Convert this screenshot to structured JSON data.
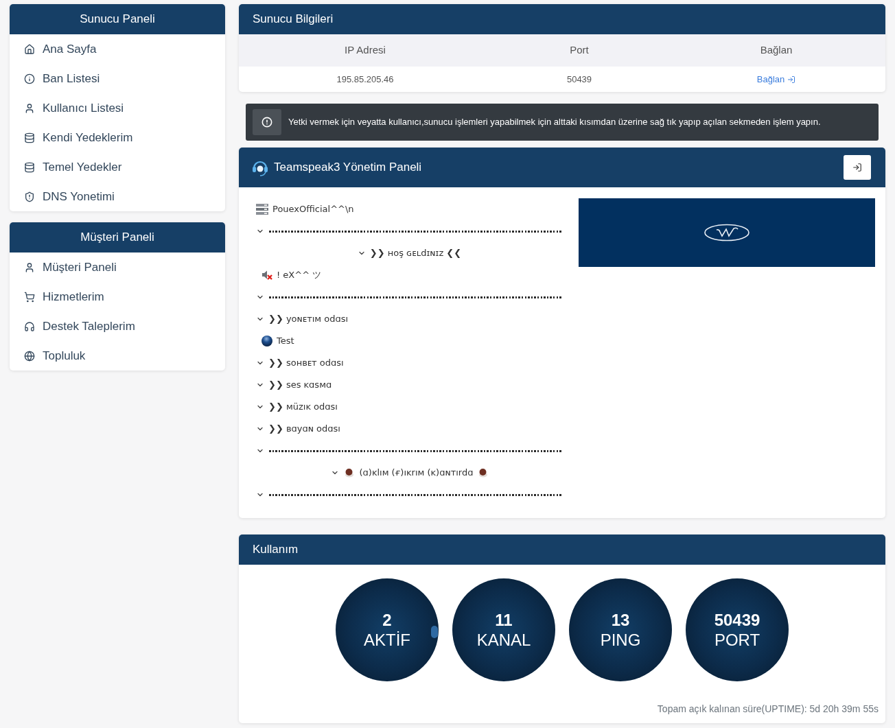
{
  "sidebar": [
    {
      "title": "Sunucu Paneli",
      "items": [
        "Ana Sayfa",
        "Ban Listesi",
        "Kullanıcı Listesi",
        "Kendi Yedeklerim",
        "Temel Yedekler",
        "DNS Yonetimi"
      ]
    },
    {
      "title": "Müşteri Paneli",
      "items": [
        "Müşteri Paneli",
        "Hizmetlerim",
        "Destek Taleplerim",
        "Topluluk"
      ]
    }
  ],
  "server_info": {
    "title": "Sunucu Bilgileri",
    "columns": [
      "IP Adresi",
      "Port",
      "Bağlan"
    ],
    "row": {
      "ip": "195.85.205.46",
      "port": "50439",
      "link": "Bağlan"
    }
  },
  "alert": {
    "text": "Yetki vermek için veyatta kullanıcı,sunucu işlemleri yapabilmek için alttaki kısımdan üzerine sağ tık yapıp açılan sekmeden işlem yapın."
  },
  "ts_panel": {
    "title": "Teamspeak3 Yönetim Paneli",
    "tree": {
      "server": "PouexOfficial^^\\n",
      "channels": [
        {
          "kind": "spacer",
          "expanded": true
        },
        {
          "kind": "centered",
          "name": "❯❯ ʜᴏş ɢᴇʟdɪɴɪᴢ ❮❮",
          "expanded": true,
          "children": [
            {
              "name": "! eX^^ ツ",
              "muted": true
            }
          ]
        },
        {
          "kind": "spacer",
          "expanded": true
        },
        {
          "kind": "channel",
          "name": "❯❯ yoɴᴇᴛıᴍ odɑsı",
          "expanded": true,
          "children": [
            {
              "name": "Test",
              "muted": false
            }
          ]
        },
        {
          "kind": "channel",
          "name": "❯❯ ꜱᴏʜʙᴇᴛ odɑsı",
          "expanded": true
        },
        {
          "kind": "channel",
          "name": "❯❯ ses ᴋɑsᴍɑ",
          "expanded": true
        },
        {
          "kind": "channel",
          "name": "❯❯ ᴍüᴢıᴋ odɑsı",
          "expanded": true
        },
        {
          "kind": "channel",
          "name": "❯❯ ʙɑyɑɴ odɑsı",
          "expanded": true
        },
        {
          "kind": "spacer",
          "expanded": true
        },
        {
          "kind": "ornate",
          "name": "(ɑ)ᴋlıᴍ (ғ)ıᴋrıᴍ (ᴋ)ɑɴᴛırdɑ",
          "expanded": true
        },
        {
          "kind": "spacer",
          "expanded": true
        }
      ]
    }
  },
  "usage": {
    "title": "Kullanım",
    "stats": [
      {
        "value": "2",
        "label": "AKTİF",
        "marker": true
      },
      {
        "value": "11",
        "label": "KANAL",
        "marker": false
      },
      {
        "value": "13",
        "label": "PING",
        "marker": false
      },
      {
        "value": "50439",
        "label": "PORT",
        "marker": false
      }
    ],
    "uptime": "Topam açık kalınan süre(UPTIME): 5d 20h 39m 55s"
  }
}
